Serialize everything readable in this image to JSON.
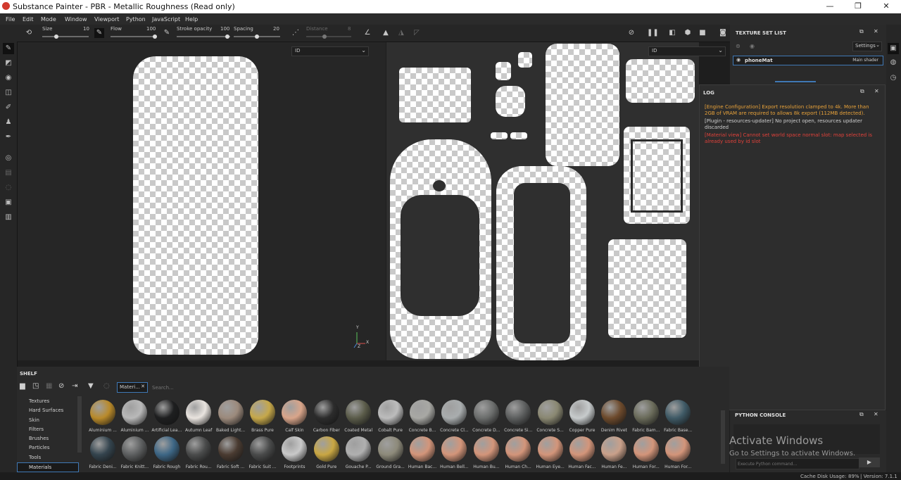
{
  "window": {
    "title": "Substance Painter - PBR - Metallic Roughness (Read only)",
    "minimize": "—",
    "maximize": "❐",
    "close": "✕"
  },
  "menu": [
    "File",
    "Edit",
    "Mode",
    "Window",
    "Viewport",
    "Python",
    "JavaScript",
    "Help"
  ],
  "toolbar": {
    "size_label": "Size",
    "size_value": "10",
    "flow_label": "Flow",
    "flow_value": "100",
    "stroke_opacity_label": "Stroke opacity",
    "stroke_opacity_value": "100",
    "spacing_label": "Spacing",
    "spacing_value": "20",
    "distance_label": "Distance",
    "distance_value": "8"
  },
  "viewport_3d": {
    "channel_select": "ID",
    "axis_x": "X",
    "axis_y": "Y",
    "axis_z": "Z"
  },
  "viewport_2d": {
    "channel_select": "ID"
  },
  "texture_set_list": {
    "title": "TEXTURE SET LIST",
    "settings_button": "Settings",
    "item_name": "phoneMat",
    "item_shader": "Main shader"
  },
  "log": {
    "title": "LOG",
    "messages": [
      {
        "text": "[Engine Configuration] Export resolution clamped to 4k. More than 2GB of VRAM are required to allows 8k export (112MB detected).",
        "color": "#e8a23a"
      },
      {
        "text": "[Plugin - resources-updater] No project open, resources updater discarded",
        "color": "#cfcfcf"
      },
      {
        "text": "[Material view] Cannot set world space normal slot: map selected is already used by id slot",
        "color": "#e0413a"
      }
    ]
  },
  "shelf": {
    "title": "SHELF",
    "search_tag": "Materi...",
    "search_placeholder": "Search...",
    "categories": [
      "Textures",
      "Hard Surfaces",
      "Skin",
      "Filters",
      "Brushes",
      "Particles",
      "Tools",
      "Materials"
    ],
    "selected_category": "Materials",
    "materials_row1": [
      {
        "name": "Aluminium ...",
        "color": "#b98a2a"
      },
      {
        "name": "Aluminium ...",
        "color": "#b9b9b9"
      },
      {
        "name": "Artificial Lea...",
        "color": "#1e1f20"
      },
      {
        "name": "Autumn Leaf",
        "color": "#e9e4df"
      },
      {
        "name": "Baked Light...",
        "color": "#9c8a7c"
      },
      {
        "name": "Brass Pure",
        "color": "#c6a84a"
      },
      {
        "name": "Calf Skin",
        "color": "#d9a58a"
      },
      {
        "name": "Carbon Fiber",
        "color": "#2c2c2c"
      },
      {
        "name": "Coated Metal",
        "color": "#5b5c4a"
      },
      {
        "name": "Cobalt Pure",
        "color": "#bcbcbc"
      },
      {
        "name": "Concrete B...",
        "color": "#a8a8a4"
      },
      {
        "name": "Concrete Cl...",
        "color": "#a9adae"
      },
      {
        "name": "Concrete D...",
        "color": "#6b6d6c"
      },
      {
        "name": "Concrete Si...",
        "color": "#5d5f5f"
      },
      {
        "name": "Concrete S...",
        "color": "#8a8872"
      },
      {
        "name": "Copper Pure",
        "color": "#c7cbcc"
      },
      {
        "name": "Denim Rivet",
        "color": "#6d4a2c"
      },
      {
        "name": "Fabric Bam...",
        "color": "#6a6b5a"
      },
      {
        "name": "Fabric Base...",
        "color": "#3f5a66"
      }
    ],
    "materials_row2": [
      {
        "name": "Fabric Deni...",
        "color": "#34444e"
      },
      {
        "name": "Fabric Knitt...",
        "color": "#5d5f60"
      },
      {
        "name": "Fabric Rough",
        "color": "#3d6685"
      },
      {
        "name": "Fabric Rou...",
        "color": "#4a4b4b"
      },
      {
        "name": "Fabric Soft ...",
        "color": "#4a3b31"
      },
      {
        "name": "Fabric Suit ...",
        "color": "#4a4b4b"
      },
      {
        "name": "Footprints",
        "color": "#c9c9c9"
      },
      {
        "name": "Gold Pure",
        "color": "#c9a743"
      },
      {
        "name": "Gouache P...",
        "color": "#b0b0b0"
      },
      {
        "name": "Ground Gra...",
        "color": "#8d8a7a"
      },
      {
        "name": "Human Bac...",
        "color": "#d3957a"
      },
      {
        "name": "Human Bell...",
        "color": "#d3957a"
      },
      {
        "name": "Human Bu...",
        "color": "#d3957a"
      },
      {
        "name": "Human Ch...",
        "color": "#d3957a"
      },
      {
        "name": "Human Eye...",
        "color": "#d3957a"
      },
      {
        "name": "Human Fac...",
        "color": "#d3957a"
      },
      {
        "name": "Human Fe...",
        "color": "#c9a08a"
      },
      {
        "name": "Human For...",
        "color": "#d3957a"
      },
      {
        "name": "Human For...",
        "color": "#d3957a"
      }
    ]
  },
  "python_console": {
    "title": "PYTHON CONSOLE",
    "input_placeholder": "Execute Python command...",
    "watermark_line1": "Activate Windows",
    "watermark_line2": "Go to Settings to activate Windows."
  },
  "statusbar": {
    "cache_label": "Cache Disk Usage:",
    "cache_value": "89%",
    "version": "| Version: 7.1.1"
  }
}
